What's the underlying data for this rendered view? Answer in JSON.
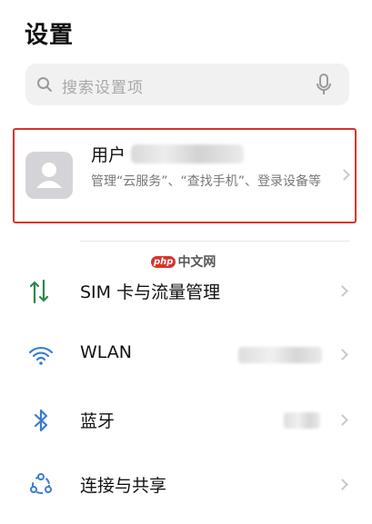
{
  "header": {
    "title": "设置"
  },
  "search": {
    "placeholder": "搜索设置项"
  },
  "account": {
    "name_prefix": "用户",
    "subtitle": "管理“云服务”、“查找手机”、登录设备等"
  },
  "watermark": {
    "badge": "php",
    "text": "中文网"
  },
  "rows": [
    {
      "label": "SIM 卡与流量管理",
      "icon": "sim-traffic-icon"
    },
    {
      "label": "WLAN",
      "icon": "wifi-icon"
    },
    {
      "label": "蓝牙",
      "icon": "bluetooth-icon"
    },
    {
      "label": "连接与共享",
      "icon": "share-connection-icon"
    }
  ],
  "colors": {
    "highlight_border": "#d9342b",
    "icon_blue": "#3a7bd5"
  }
}
